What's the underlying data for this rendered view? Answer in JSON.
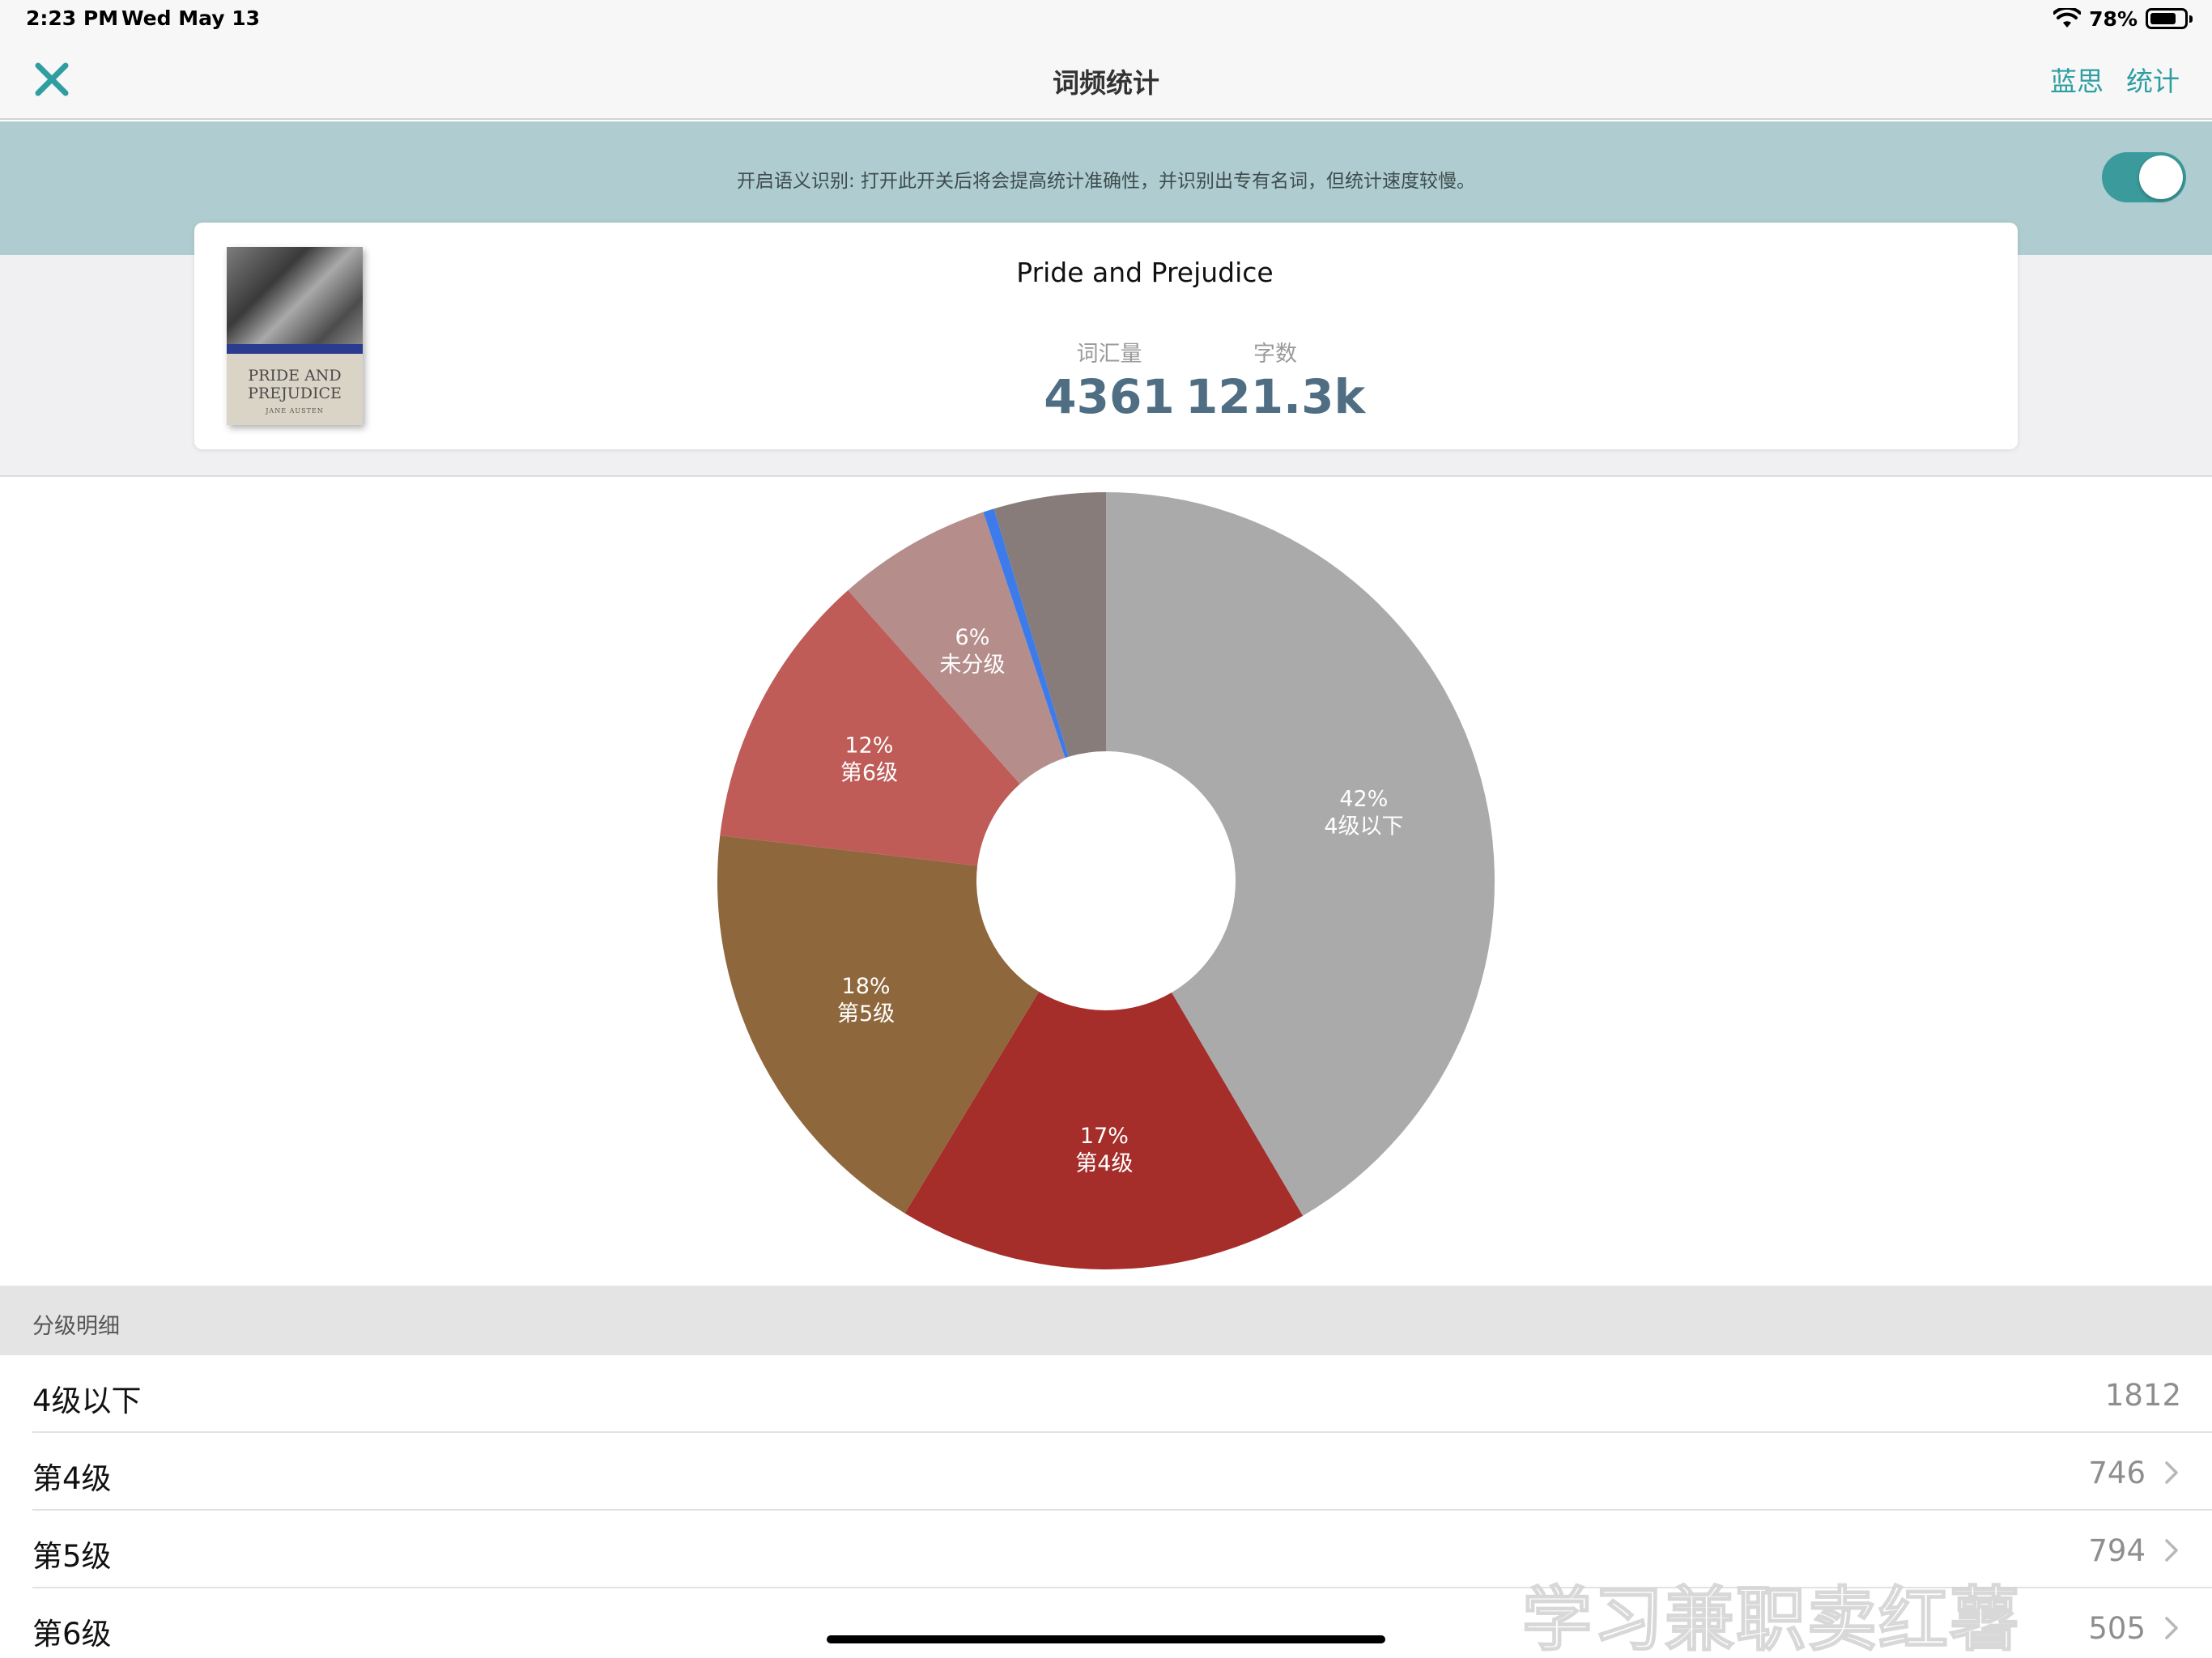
{
  "status_bar": {
    "time": "2:23 PM",
    "date": "Wed May 13",
    "battery_percent": "78%",
    "battery_level": 0.78
  },
  "nav": {
    "title": "词频统计",
    "actions": [
      "蓝思",
      "统计"
    ]
  },
  "banner": {
    "text": "开启语义识别: 打开此开关后将会提高统计准确性，并识别出专有名词，但统计速度较慢。",
    "toggle_on": true
  },
  "book": {
    "title": "Pride and Prejudice",
    "cover_title": "PRIDE AND PREJUDICE",
    "cover_author": "JANE AUSTEN",
    "vocab_label": "词汇量",
    "vocab_value": "4361",
    "words_label": "字数",
    "words_value": "121.3k"
  },
  "chart_data": {
    "type": "pie",
    "slices": [
      {
        "label": "4级以下",
        "percent_label": "42%",
        "value": 1812,
        "color": "#aaaaaa"
      },
      {
        "label": "第4级",
        "percent_label": "17%",
        "value": 746,
        "color": "#a52d2a"
      },
      {
        "label": "第5级",
        "percent_label": "18%",
        "value": 794,
        "color": "#8f673c"
      },
      {
        "label": "第6级",
        "percent_label": "12%",
        "value": 505,
        "color": "#bf5c58"
      },
      {
        "label": "未分级",
        "percent_label": "6%",
        "value": 281,
        "color": "#b58e8c"
      },
      {
        "label": "",
        "percent_label": "",
        "value": 20,
        "color": "#3e7bea"
      },
      {
        "label": "",
        "percent_label": "",
        "value": 203,
        "color": "#887c7a"
      }
    ]
  },
  "breakdown": {
    "header": "分级明细",
    "rows": [
      {
        "name": "4级以下",
        "count": "1812",
        "chevron": false
      },
      {
        "name": "第4级",
        "count": "746",
        "chevron": true
      },
      {
        "name": "第5级",
        "count": "794",
        "chevron": true
      },
      {
        "name": "第6级",
        "count": "505",
        "chevron": true
      }
    ]
  },
  "watermark": "学习兼职卖红薯"
}
